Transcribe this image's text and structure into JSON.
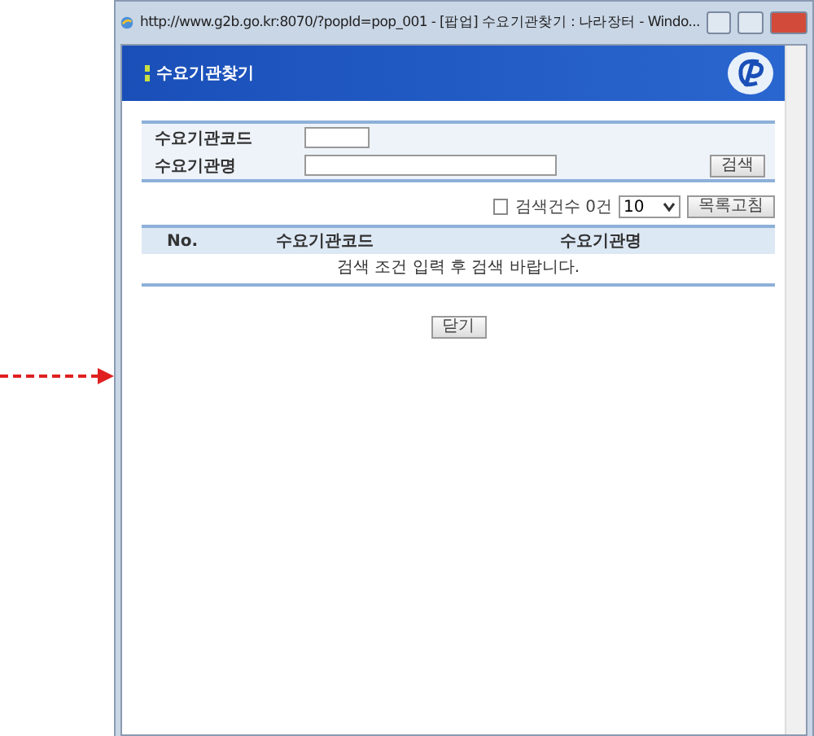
{
  "window": {
    "title": "http://www.g2b.go.kr:8070/?popId=pop_001 - [팝업] 수요기관찾기 : 나라장터 - Windo..."
  },
  "header": {
    "title": "수요기관찾기"
  },
  "search_form": {
    "fields": [
      {
        "label": "수요기관코드"
      },
      {
        "label": "수요기관명"
      }
    ],
    "button": "검색"
  },
  "result_bar": {
    "count": "검색건수 0건",
    "page_size": "10",
    "refresh_button": "목록고침"
  },
  "table": {
    "columns": [
      "No.",
      "수요기관코드",
      "수요기관명"
    ],
    "empty_message": "검색 조건 입력 후 검색 바랍니다."
  },
  "close_button": "닫기"
}
